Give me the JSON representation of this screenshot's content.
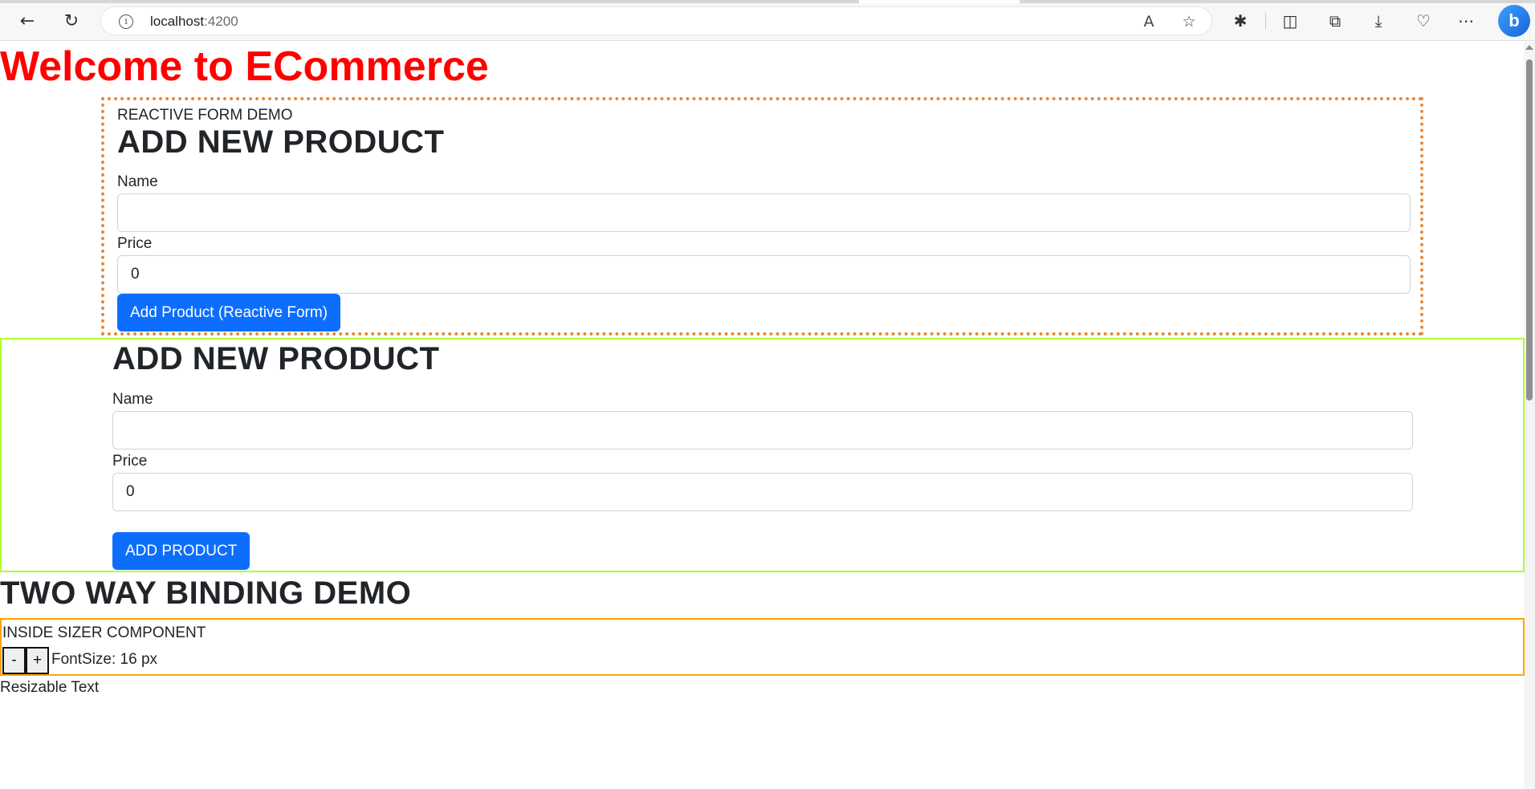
{
  "browser": {
    "url_host": "localhost",
    "url_port": ":4200",
    "icons": {
      "back": "←",
      "reload": "↻",
      "info": "i",
      "read_aloud": "A",
      "favorite": "☆",
      "extensions": "✱",
      "split": "◫",
      "collections": "⧉",
      "downloads": "⤓",
      "health": "♡",
      "more": "⋯",
      "copilot": "b"
    }
  },
  "page": {
    "title": "Welcome to ECommerce",
    "title_color": "#ff0000"
  },
  "reactive_form": {
    "caption": "REACTIVE FORM DEMO",
    "heading": "ADD NEW PRODUCT",
    "name_label": "Name",
    "name_value": "",
    "price_label": "Price",
    "price_value": "0",
    "submit_label": "Add Product (Reactive Form)",
    "border_color": "#e8883a"
  },
  "template_form": {
    "heading": "ADD NEW PRODUCT",
    "name_label": "Name",
    "name_value": "",
    "price_label": "Price",
    "price_value": "0",
    "submit_label": "ADD PRODUCT",
    "border_color": "#adff2f"
  },
  "two_way": {
    "heading": "TWO WAY BINDING DEMO",
    "sizer_caption": "INSIDE SIZER COMPONENT",
    "decrease_label": "-",
    "increase_label": "+",
    "font_size_text": "FontSize: 16 px",
    "resizable_text": "Resizable Text",
    "border_color": "#ffa500"
  },
  "colors": {
    "primary_button": "#0d6efd"
  }
}
